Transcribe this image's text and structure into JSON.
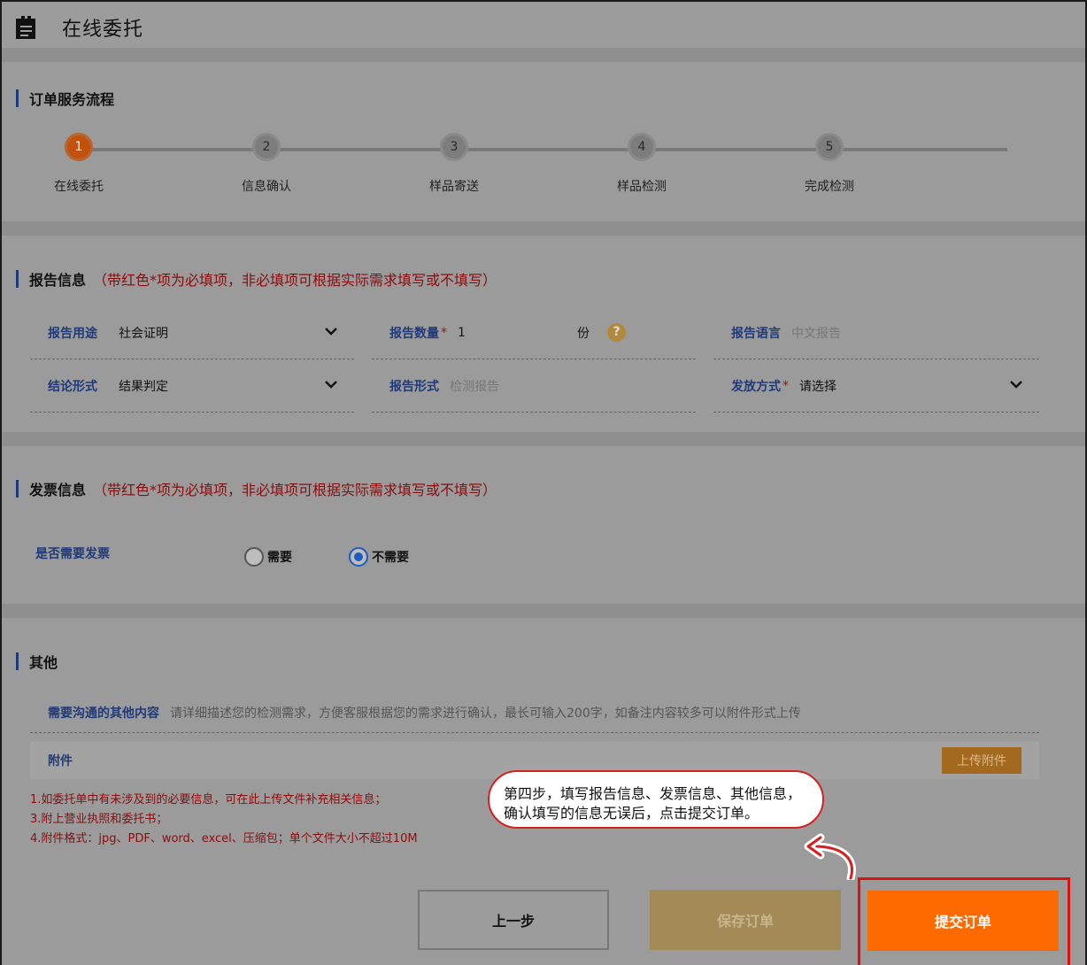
{
  "header": {
    "title": "在线委托"
  },
  "flow": {
    "title": "订单服务流程",
    "steps": [
      {
        "num": "1",
        "label": "在线委托"
      },
      {
        "num": "2",
        "label": "信息确认"
      },
      {
        "num": "3",
        "label": "样品寄送"
      },
      {
        "num": "4",
        "label": "样品检测"
      },
      {
        "num": "5",
        "label": "完成检测"
      }
    ]
  },
  "report": {
    "title": "报告信息",
    "note": "（带红色*项为必填项，非必填项可根据实际需求填写或不填写）",
    "usage_label": "报告用途",
    "usage_value": "社会证明",
    "count_label": "报告数量",
    "count_value": "1",
    "count_unit": "份",
    "help_icon": "?",
    "language_label": "报告语言",
    "language_placeholder": "中文报告",
    "conclusion_label": "结论形式",
    "conclusion_value": "结果判定",
    "form_label": "报告形式",
    "form_placeholder": "检测报告",
    "delivery_label": "发放方式",
    "delivery_value": "请选择",
    "required_mark": "*"
  },
  "invoice": {
    "title": "发票信息",
    "note": "（带红色*项为必填项，非必填项可根据实际需求填写或不填写）",
    "question": "是否需要发票",
    "option_yes": "需要",
    "option_no": "不需要",
    "selected": "不需要"
  },
  "other": {
    "title": "其他",
    "content_label": "需要沟通的其他内容",
    "content_placeholder": "请详细描述您的检测需求，方便客服根据您的需求进行确认，最长可输入200字，如备注内容较多可以附件形式上传",
    "attachment_label": "附件",
    "upload_label": "上传附件",
    "notes": [
      "1.如委托单中有未涉及到的必要信息，可在此上传文件补充相关信息；",
      "3.附上营业执照和委托书；",
      "4.附件格式：jpg、PDF、word、excel、压缩包；单个文件大小不超过10M"
    ]
  },
  "footer": {
    "prev_label": "上一步",
    "save_label": "保存订单",
    "submit_label": "提交订单"
  },
  "callout": {
    "text": "第四步，填写报告信息、发票信息、其他信息，确认填写的信息无误后，点击提交订单。"
  },
  "colors": {
    "accent_orange": "#ff6a00",
    "active_step": "#c2510d",
    "label_blue": "#1f3a7a",
    "note_red": "#8a0d0d",
    "highlight_red": "#e01010"
  }
}
